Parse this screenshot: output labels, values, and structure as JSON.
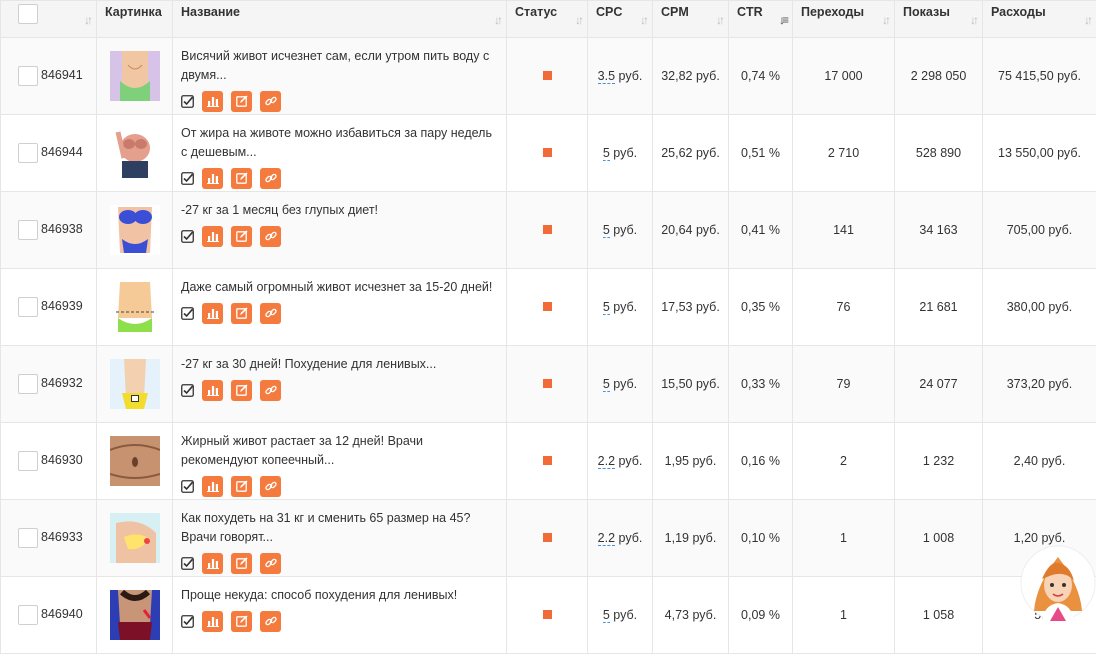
{
  "columns": [
    {
      "key": "select",
      "label": ""
    },
    {
      "key": "image",
      "label": "Картинка"
    },
    {
      "key": "name",
      "label": "Название"
    },
    {
      "key": "status",
      "label": "Статус"
    },
    {
      "key": "cpc",
      "label": "CPC"
    },
    {
      "key": "cpm",
      "label": "CPM"
    },
    {
      "key": "ctr",
      "label": "CTR"
    },
    {
      "key": "clicks",
      "label": "Переходы"
    },
    {
      "key": "impressions",
      "label": "Показы"
    },
    {
      "key": "spend",
      "label": "Расходы"
    }
  ],
  "currency_suffix": "руб.",
  "rows": [
    {
      "id": "846941",
      "title": "Висячий живот исчезнет сам, если утром пить воду с двумя...",
      "cpc": "3.5",
      "cpm": "32,82 руб.",
      "ctr": "0,74 %",
      "clicks": "17 000",
      "impressions": "2 298 050",
      "spend": "75 415,50 руб.",
      "thumb_icon": "belly-waist-thumbnail-icon"
    },
    {
      "id": "846944",
      "title": "От жира на животе можно избавиться за пару недель с дешевым...",
      "cpc": "5",
      "cpm": "25,62 руб.",
      "ctr": "0,51 %",
      "clicks": "2 710",
      "impressions": "528 890",
      "spend": "13 550,00 руб.",
      "thumb_icon": "woman-torso-thumbnail-icon"
    },
    {
      "id": "846938",
      "title": "-27 кг за 1 месяц без глупых диет!",
      "cpc": "5",
      "cpm": "20,64 руб.",
      "ctr": "0,41 %",
      "clicks": "141",
      "impressions": "34 163",
      "spend": "705,00 руб.",
      "thumb_icon": "blue-bikini-thumbnail-icon"
    },
    {
      "id": "846939",
      "title": "Даже самый огромный живот исчезнет за 15-20 дней!",
      "cpc": "5",
      "cpm": "17,53 руб.",
      "ctr": "0,35 %",
      "clicks": "76",
      "impressions": "21 681",
      "spend": "380,00 руб.",
      "thumb_icon": "measured-belly-thumbnail-icon"
    },
    {
      "id": "846932",
      "title": "-27 кг за 30 дней! Похудение для ленивых...",
      "cpc": "5",
      "cpm": "15,50 руб.",
      "ctr": "0,33 %",
      "clicks": "79",
      "impressions": "24 077",
      "spend": "373,20 руб.",
      "thumb_icon": "slim-waist-thumbnail-icon"
    },
    {
      "id": "846930",
      "title": "Жирный живот растает за 12 дней! Врачи рекомендуют копеечный...",
      "cpc": "2.2",
      "cpm": "1,95 руб.",
      "ctr": "0,16 %",
      "clicks": "2",
      "impressions": "1 232",
      "spend": "2,40 руб.",
      "thumb_icon": "belly-closeup-thumbnail-icon"
    },
    {
      "id": "846933",
      "title": "Как похудеть на 31 кг и сменить 65 размер на 45? Врачи говорят...",
      "cpc": "2.2",
      "cpm": "1,19 руб.",
      "ctr": "0,10 %",
      "clicks": "1",
      "impressions": "1 008",
      "spend": "1,20 руб.",
      "thumb_icon": "hip-thumbnail-icon"
    },
    {
      "id": "846940",
      "title": "Проще некуда: способ похудения для ленивых!",
      "cpc": "5",
      "cpm": "4,73 руб.",
      "ctr": "0,09 %",
      "clicks": "1",
      "impressions": "1 058",
      "spend": "5,",
      "thumb_icon": "woman-back-thumbnail-icon"
    }
  ],
  "icons": {
    "sort": "sort-arrows-icon",
    "sort_active": "sort-desc-icon",
    "approve": "check-square-icon",
    "stats": "bar-chart-icon",
    "edit": "edit-icon",
    "link": "link-icon",
    "support": "support-avatar-icon"
  },
  "colors": {
    "accent": "#f47a3e",
    "status": "#f26a37",
    "header_bg": "#f5f5f5",
    "link_underline": "#4a90e2"
  }
}
